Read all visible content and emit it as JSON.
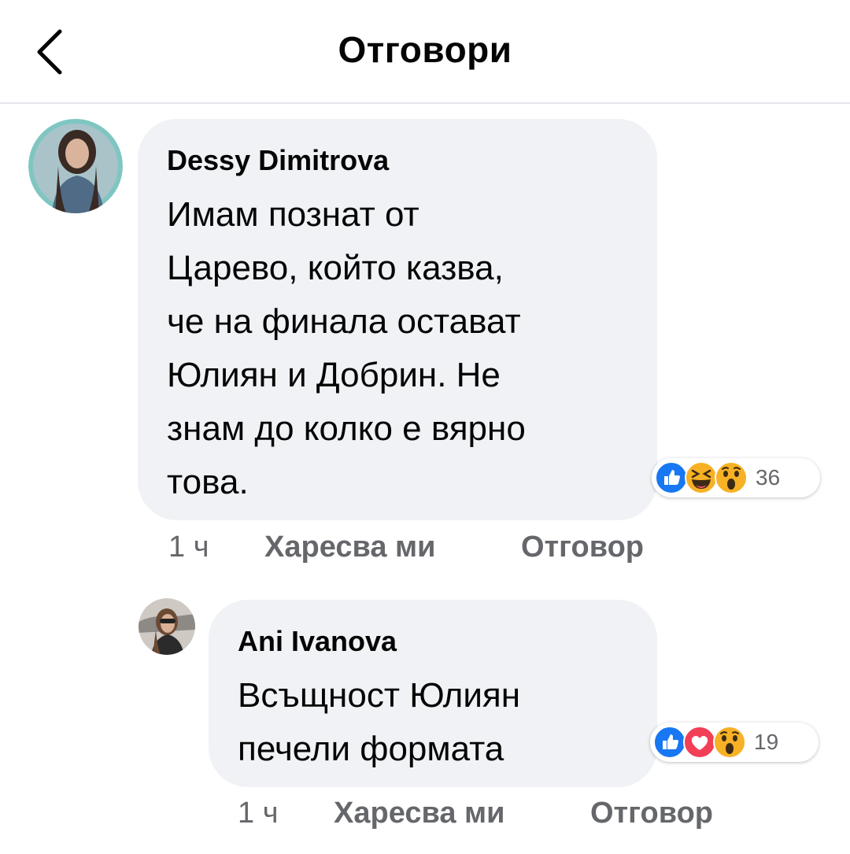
{
  "header": {
    "title": "Отговори",
    "back_icon": "chevron-left-icon"
  },
  "comment": {
    "author": "Dessy Dimitrova",
    "lines": [
      "Имам познат от",
      "Царево, който казва,",
      "че на финала остават",
      "Юлиян и Добрин. Не",
      "знам до колко е вярно",
      "това."
    ],
    "reactions": {
      "icons": [
        "like-icon",
        "haha-icon",
        "wow-icon"
      ],
      "count": "36"
    },
    "time": "1 ч",
    "like_label": "Харесва ми",
    "reply_label": "Отговор"
  },
  "reply": {
    "author": "Ani Ivanova",
    "lines": [
      "Всъщност Юлиян",
      "печели формата"
    ],
    "reactions": {
      "icons": [
        "like-icon",
        "love-icon",
        "wow-icon"
      ],
      "count": "19"
    },
    "time": "1 ч",
    "like_label": "Харесва ми",
    "reply_label": "Отговор"
  },
  "colors": {
    "bubble": "#f0f2f5",
    "meta_text": "#65676b",
    "like_blue": "#1877f2",
    "love_red": "#f33e58",
    "emoji_yellow": "#f7b125"
  }
}
